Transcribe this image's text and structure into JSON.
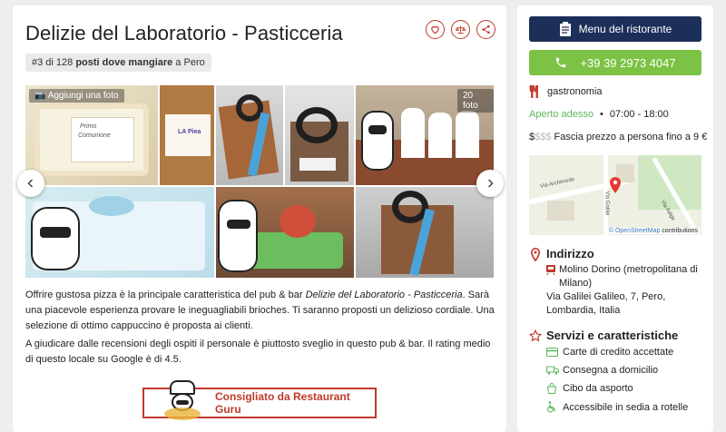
{
  "header": {
    "title": "Delizie del Laboratorio - Pasticceria",
    "rank_prefix": "#3 di 128",
    "rank_bold": "posti dove mangiare",
    "rank_suffix": "a Pero"
  },
  "gallery": {
    "add_photo_label": "Aggiungi una foto",
    "photo_count": "20 foto",
    "photo_texts": [
      "Primo",
      "Comunione",
      "LA Piea"
    ]
  },
  "description": {
    "p1_a": "Offrire gustosa pizza è la principale caratteristica del pub & bar ",
    "p1_name": "Delizie del Laboratorio - Pasticceria",
    "p1_b": ". Sarà una piacevole esperienza provare le ineguagliabili brioches. Ti saranno proposti un delizioso cordiale. Una selezione di ottimo cappuccino è proposta ai clienti.",
    "p2": "A giudicare dalle recensioni degli ospiti il personale è piuttosto sveglio in questo pub & bar. Il rating medio di questo locale su Google è di 4.5."
  },
  "recommend": {
    "label": "Consigliato da Restaurant Guru"
  },
  "sidebar": {
    "menu_button": "Menu del ristorante",
    "phone_button": "+39 39 2973 4047",
    "cuisine": "gastronomia",
    "open_status": "Aperto adesso",
    "hours": "07:00 - 18:00",
    "price_symbols_active": "$",
    "price_symbols_inactive": "$$$",
    "price_text": "Fascia prezzo a persona fino a 9 €",
    "map_street_1": "Via Archimede",
    "map_street_2": "Via Galilei",
    "map_street_3": "Via Adige",
    "map_credit_link": "© OpenStreetMap",
    "map_credit_rest": "contributions",
    "address_title": "Indirizzo",
    "metro_station": "Molino Dorino (metropolitana di Milano)",
    "address": "Via Galilei Galileo, 7, Pero, Lombardia, Italia",
    "services_title": "Servizi e caratteristiche",
    "services": [
      "Carte di credito accettate",
      "Consegna a domicilio",
      "Cibo da asporto",
      "Accessibile in sedia a rotelle"
    ]
  },
  "colors": {
    "accent_red": "#c0392b",
    "menu_blue": "#1c2f59",
    "phone_green": "#7cc244",
    "open_green": "#5cb85c"
  }
}
